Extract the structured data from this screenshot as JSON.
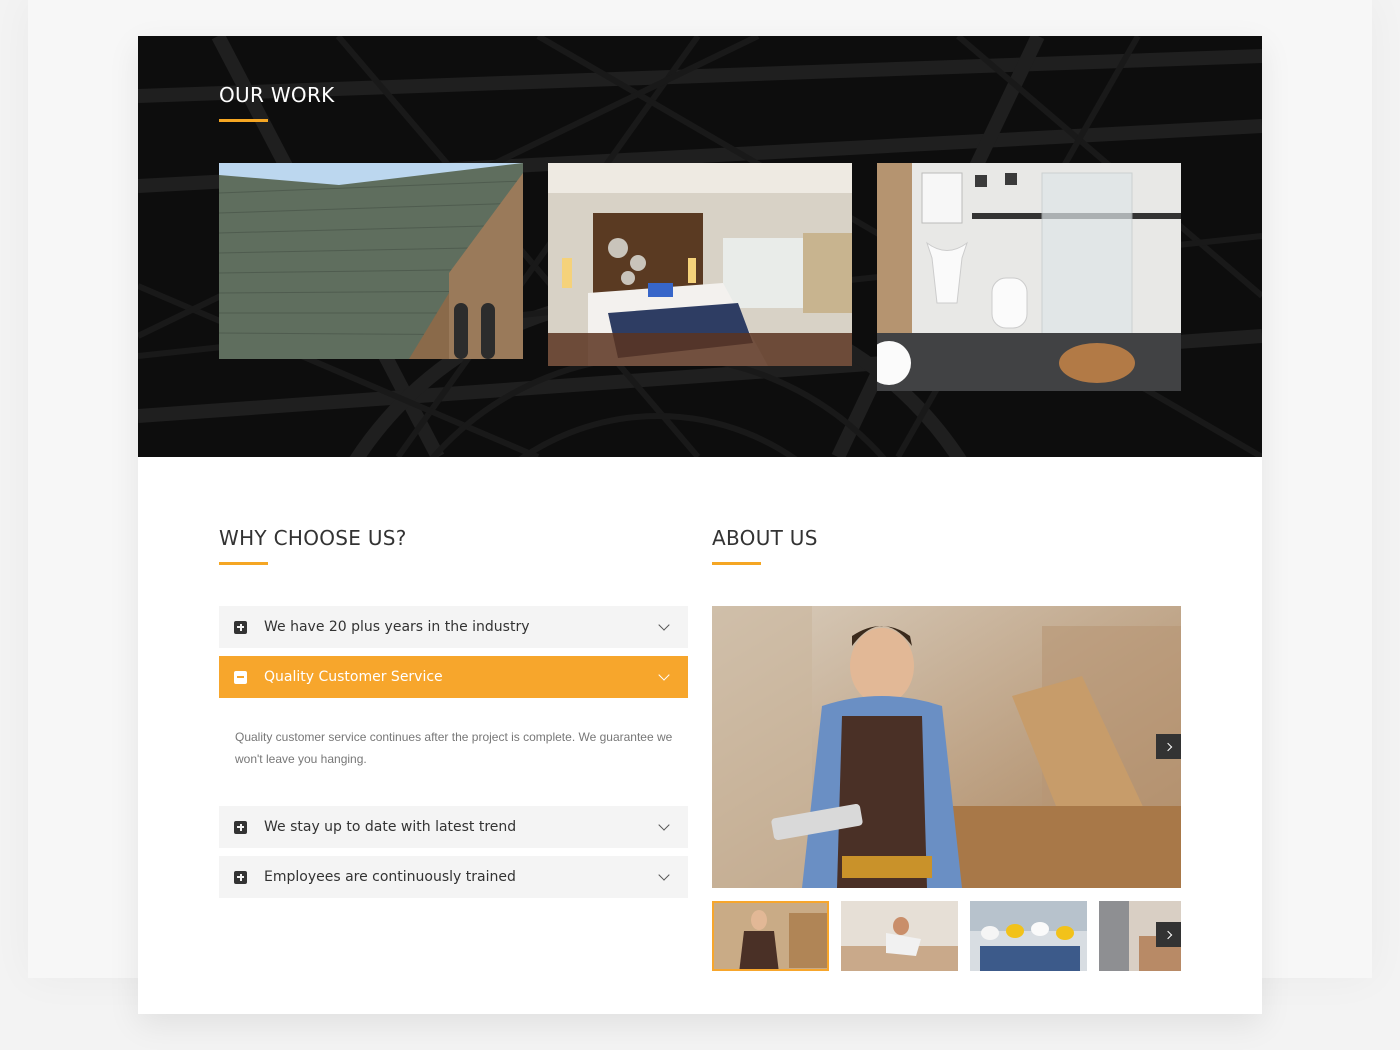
{
  "our_work": {
    "title": "OUR WORK",
    "projects": [
      {
        "name": "roof-project-photo"
      },
      {
        "name": "bedroom-project-photo"
      },
      {
        "name": "bathroom-project-photo"
      }
    ]
  },
  "why_choose": {
    "title": "WHY CHOOSE US?",
    "items": [
      {
        "label": "We have 20 plus years in the industry",
        "expanded": false
      },
      {
        "label": "Quality Customer Service",
        "expanded": true,
        "body": "Quality customer service continues after the project is complete. We guarantee we won't leave you hanging."
      },
      {
        "label": "We stay up to date with latest trend",
        "expanded": false
      },
      {
        "label": "Employees are continuously trained",
        "expanded": false
      }
    ]
  },
  "about": {
    "title": "ABOUT US",
    "thumbnails": [
      "carpenter-thumb",
      "worker-floor-thumb",
      "team-hardhats-thumb",
      "interior-thumb"
    ],
    "selected_thumb": 0
  },
  "colors": {
    "accent": "#f7a62c",
    "dark": "#111111",
    "text": "#333333"
  }
}
